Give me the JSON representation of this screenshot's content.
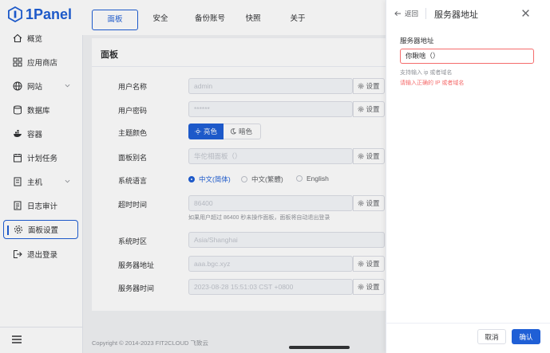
{
  "app": {
    "logo_text": "1Panel"
  },
  "sidebar": {
    "items": [
      {
        "label": "概览",
        "icon": "home-icon"
      },
      {
        "label": "应用商店",
        "icon": "apps-icon"
      },
      {
        "label": "网站",
        "icon": "globe-icon",
        "has_children": true
      },
      {
        "label": "数据库",
        "icon": "database-icon"
      },
      {
        "label": "容器",
        "icon": "docker-icon"
      },
      {
        "label": "计划任务",
        "icon": "calendar-icon"
      },
      {
        "label": "主机",
        "icon": "host-icon",
        "has_children": true
      },
      {
        "label": "日志审计",
        "icon": "log-icon"
      },
      {
        "label": "面板设置",
        "icon": "gear-icon",
        "active": true
      },
      {
        "label": "退出登录",
        "icon": "logout-icon"
      }
    ]
  },
  "tabs": [
    {
      "label": "面板",
      "active": true
    },
    {
      "label": "安全"
    },
    {
      "label": "备份账号"
    },
    {
      "label": "快照"
    },
    {
      "label": "关于"
    }
  ],
  "panel": {
    "title": "面板",
    "set_label": "设置",
    "fields": {
      "username": {
        "label": "用户名称",
        "value": "admin"
      },
      "password": {
        "label": "用户密码",
        "value": "******"
      },
      "theme": {
        "label": "主题颜色",
        "light": "亮色",
        "dark": "暗色"
      },
      "alias": {
        "label": "面板别名",
        "value": "华佗相面板（）"
      },
      "language": {
        "label": "系统语言",
        "options": [
          "中文(简体)",
          "中文(繁體)",
          "English"
        ],
        "selected": "中文(简体)"
      },
      "timeout": {
        "label": "超时时间",
        "value": "86400",
        "hint": "如果用户超过 86400 秒未操作面板，面板将自动退出登录"
      },
      "timezone": {
        "label": "系统时区",
        "value": "Asia/Shanghai"
      },
      "server_addr": {
        "label": "服务器地址",
        "value": "aaa.bgc.xyz"
      },
      "server_time": {
        "label": "服务器时间",
        "value": "2023-08-28 15:51:03 CST +0800"
      }
    }
  },
  "footer": {
    "copyright": "Copyright © 2014-2023 FIT2CLOUD 飞致云"
  },
  "drawer": {
    "back_label": "返回",
    "title": "服务器地址",
    "field_label": "服务器地址",
    "input_value": "你瞅啥（）",
    "help": "支持输入 ip 或者域名",
    "error": "请输入正确的 IP 或者域名",
    "cancel_label": "取消",
    "confirm_label": "确认"
  },
  "colors": {
    "primary": "#1f5fd6",
    "error": "#f56c6c"
  }
}
